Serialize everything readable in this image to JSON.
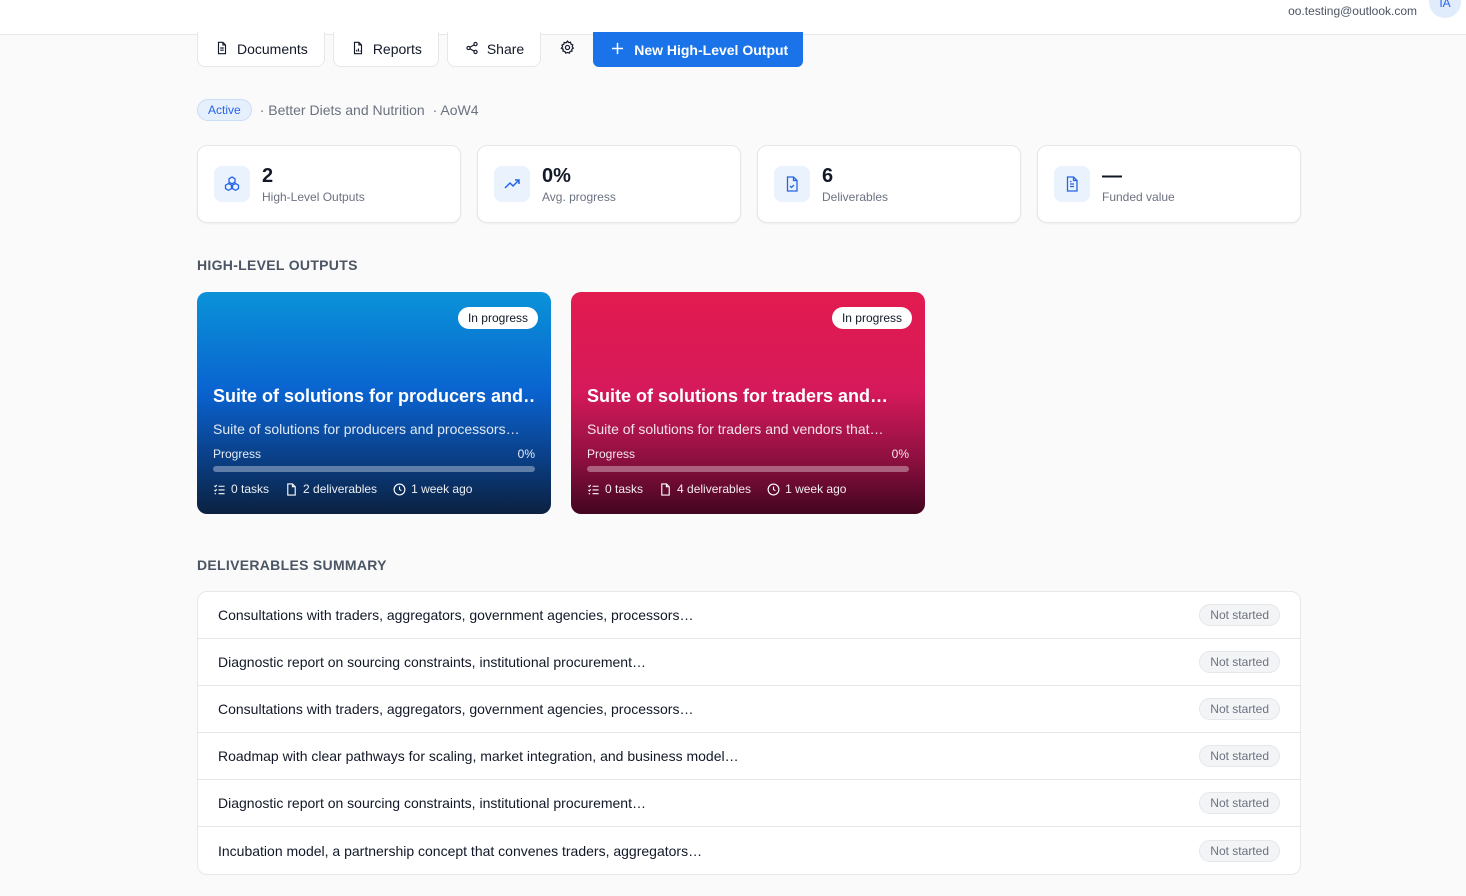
{
  "header": {
    "user_email": "oo.testing@outlook.com",
    "avatar_initials": "IA"
  },
  "toolbar": {
    "documents_label": "Documents",
    "reports_label": "Reports",
    "share_label": "Share",
    "settings_icon": "gear-icon",
    "new_output_label": "New High-Level Output"
  },
  "meta": {
    "status": "Active",
    "area": "· Better Diets and Nutrition",
    "code": "· AoW4"
  },
  "stats": [
    {
      "value": "2",
      "label": "High-Level Outputs",
      "icon": "outputs-icon"
    },
    {
      "value": "0%",
      "label": "Avg. progress",
      "icon": "trending-up-icon"
    },
    {
      "value": "6",
      "label": "Deliverables",
      "icon": "file-check-icon"
    },
    {
      "value": "—",
      "label": "Funded value",
      "icon": "document-icon"
    }
  ],
  "sections": {
    "high_level_outputs": "HIGH-LEVEL OUTPUTS",
    "deliverables_summary": "DELIVERABLES SUMMARY"
  },
  "outputs": [
    {
      "status": "In progress",
      "title": "Suite of solutions for producers and…",
      "description": "Suite of solutions for producers and processors…",
      "progress_label": "Progress",
      "progress_text": "0%",
      "progress": 0,
      "tasks": "0 tasks",
      "deliverables": "2 deliverables",
      "updated": "1 week ago",
      "color": "#0a63d0"
    },
    {
      "status": "In progress",
      "title": "Suite of solutions for traders and…",
      "description": "Suite of solutions for traders and vendors that…",
      "progress_label": "Progress",
      "progress_text": "0%",
      "progress": 0,
      "tasks": "0 tasks",
      "deliverables": "4 deliverables",
      "updated": "1 week ago",
      "color": "#d5195a"
    }
  ],
  "deliverables": [
    {
      "title": "Consultations with traders, aggregators, government agencies, processors…",
      "status": "Not started"
    },
    {
      "title": "Diagnostic report on sourcing constraints, institutional procurement…",
      "status": "Not started"
    },
    {
      "title": "Consultations with traders, aggregators, government agencies, processors…",
      "status": "Not started"
    },
    {
      "title": "Roadmap with clear pathways for scaling, market integration, and business model…",
      "status": "Not started"
    },
    {
      "title": "Diagnostic report on sourcing constraints, institutional procurement…",
      "status": "Not started"
    },
    {
      "title": "Incubation model, a partnership concept that convenes traders, aggregators…",
      "status": "Not started"
    }
  ]
}
